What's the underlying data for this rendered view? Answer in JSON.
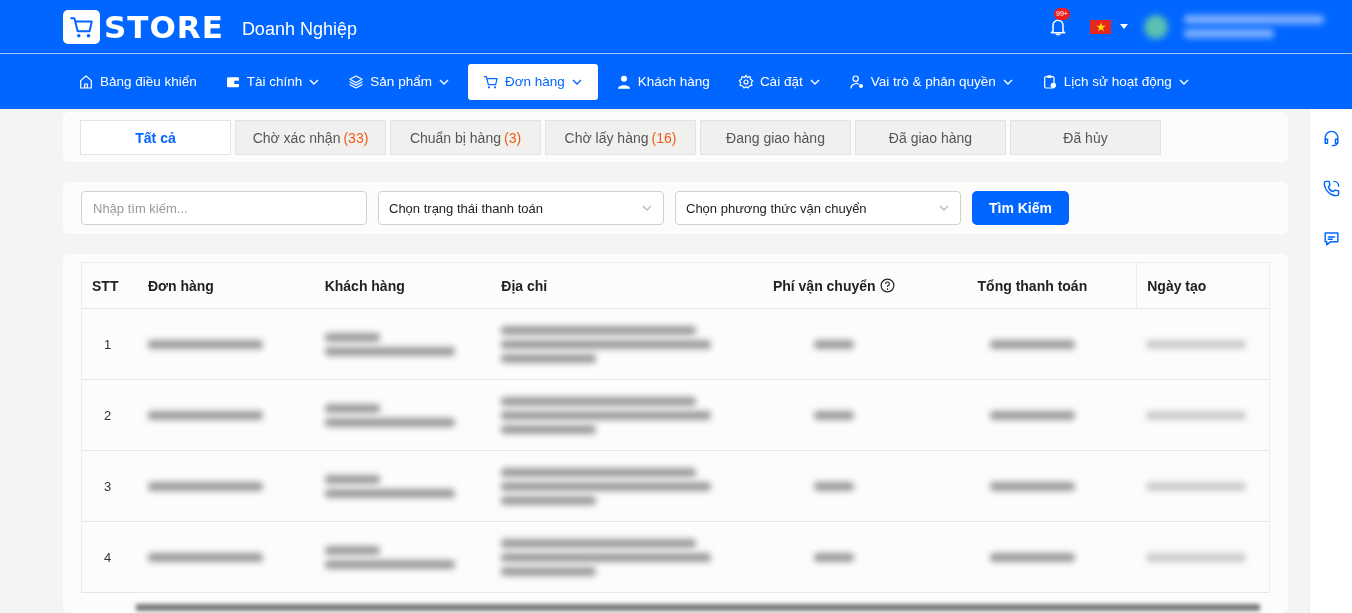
{
  "brand": {
    "logo": "STORE",
    "subtitle": "Doanh Nghiệp"
  },
  "header": {
    "notification_badge": "99+"
  },
  "nav": [
    {
      "label": "Bảng điều khiển",
      "dropdown": false,
      "selected": false
    },
    {
      "label": "Tài chính",
      "dropdown": true,
      "selected": false
    },
    {
      "label": "Sản phẩm",
      "dropdown": true,
      "selected": false
    },
    {
      "label": "Đơn hàng",
      "dropdown": true,
      "selected": true
    },
    {
      "label": "Khách hàng",
      "dropdown": false,
      "selected": false
    },
    {
      "label": "Cài đặt",
      "dropdown": true,
      "selected": false
    },
    {
      "label": "Vai trò & phân quyền",
      "dropdown": true,
      "selected": false
    },
    {
      "label": "Lịch sử hoạt động",
      "dropdown": true,
      "selected": false
    }
  ],
  "status_tabs": [
    {
      "label": "Tất cả",
      "selected": true
    },
    {
      "label": "Chờ xác nhận",
      "count": "(33)",
      "selected": false
    },
    {
      "label": "Chuẩn bị hàng",
      "count": "(3)",
      "selected": false
    },
    {
      "label": "Chờ lấy hàng",
      "count": "(16)",
      "selected": false
    },
    {
      "label": "Đang giao hàng",
      "selected": false
    },
    {
      "label": "Đã giao hàng",
      "selected": false
    },
    {
      "label": "Đã hủy",
      "selected": false
    }
  ],
  "filters": {
    "search": {
      "placeholder": "Nhập tìm kiếm..."
    },
    "selects": [
      {
        "placeholder": "Chọn trạng thái thanh toán"
      },
      {
        "placeholder": "Chọn phương thức vận chuyển"
      }
    ],
    "button": "Tìm Kiếm"
  },
  "table": {
    "columns": [
      {
        "label": "STT",
        "help": false
      },
      {
        "label": "Đơn hàng",
        "help": false
      },
      {
        "label": "Khách hàng",
        "help": false
      },
      {
        "label": "Địa chỉ",
        "help": false
      },
      {
        "label": "Phí vận chuyển",
        "help": true
      },
      {
        "label": "Tổng thanh toán",
        "help": false
      },
      {
        "label": "Ngày tạo",
        "help": false
      }
    ],
    "rows": [
      {
        "stt": "1"
      },
      {
        "stt": "2"
      },
      {
        "stt": "3"
      },
      {
        "stt": "4"
      }
    ]
  }
}
